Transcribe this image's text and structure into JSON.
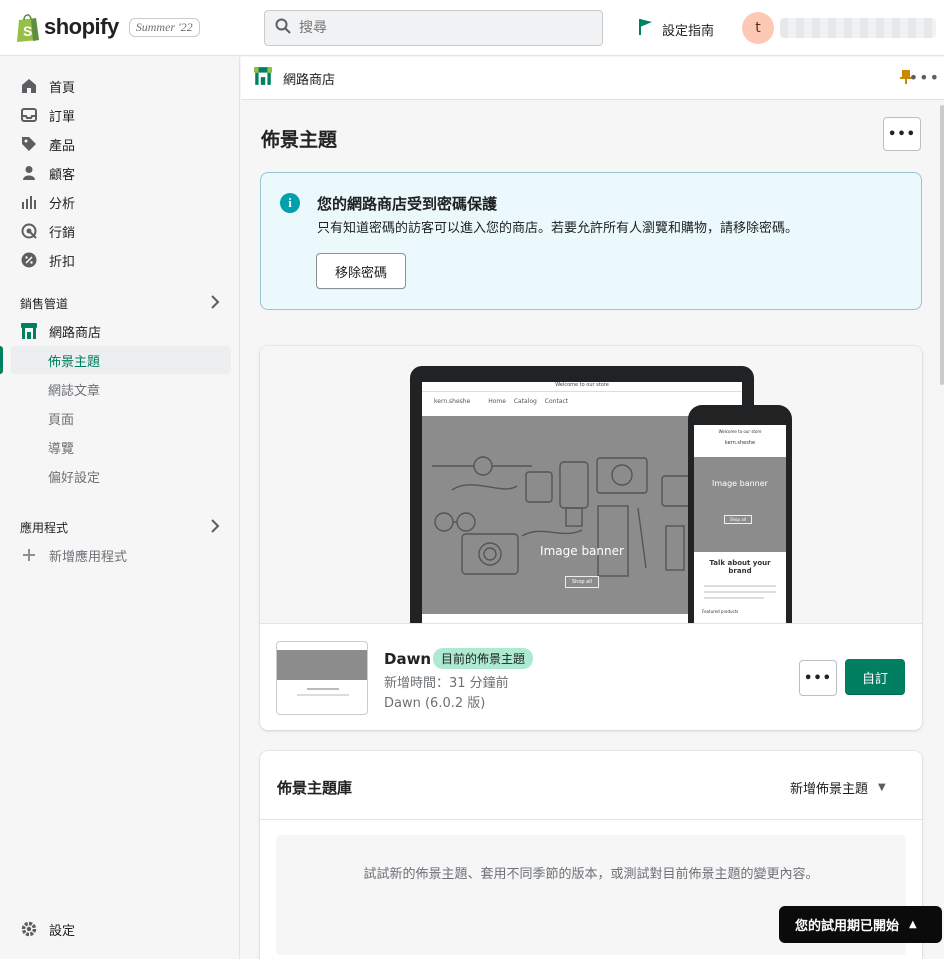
{
  "topbar": {
    "brand": "shopify",
    "edition": "Summer '22",
    "search_placeholder": "搜尋",
    "setup_guide": "設定指南",
    "avatar_initial": "t"
  },
  "sidebar": {
    "items": [
      {
        "label": "首頁",
        "icon": "home-icon"
      },
      {
        "label": "訂單",
        "icon": "orders-icon"
      },
      {
        "label": "產品",
        "icon": "tag-icon"
      },
      {
        "label": "顧客",
        "icon": "person-icon"
      },
      {
        "label": "分析",
        "icon": "bar-chart-icon"
      },
      {
        "label": "行銷",
        "icon": "target-icon"
      },
      {
        "label": "折扣",
        "icon": "discount-icon"
      }
    ],
    "sales_channels": "銷售管道",
    "online_store": "網路商店",
    "sub_items": [
      "佈景主題",
      "網誌文章",
      "頁面",
      "導覽",
      "偏好設定"
    ],
    "apps": "應用程式",
    "add_app": "新增應用程式",
    "settings": "設定"
  },
  "main": {
    "subheader_title": "網路商店",
    "page_title": "佈景主題",
    "banner": {
      "title": "您的網路商店受到密碼保護",
      "text": "只有知道密碼的訪客可以進入您的商店。若要允許所有人瀏覽和購物，請移除密碼。",
      "button": "移除密碼"
    },
    "preview": {
      "laptop_announcement": "Welcome to our store",
      "laptop_store": "kern.sheshe",
      "laptop_nav": [
        "Home",
        "Catalog",
        "Contact"
      ],
      "hero_label": "Image banner",
      "hero_button": "Shop all",
      "phone_heading": "Talk about your brand",
      "phone_featured": "Featured products"
    },
    "theme": {
      "name": "Dawn",
      "badge": "目前的佈景主題",
      "added": "新增時間：31 分鐘前",
      "version": "Dawn (6.0.2 版)",
      "customize": "自訂"
    },
    "library": {
      "title": "佈景主題庫",
      "add": "新增佈景主題",
      "empty_text": "試試新的佈景主題、套用不同季節的版本，或測試對目前佈景主題的變更內容。"
    }
  },
  "trial": "您的試用期已開始",
  "colors": {
    "accent": "#008060",
    "banner_bg": "#ebf9fc",
    "badge_bg": "#aee9d1"
  }
}
